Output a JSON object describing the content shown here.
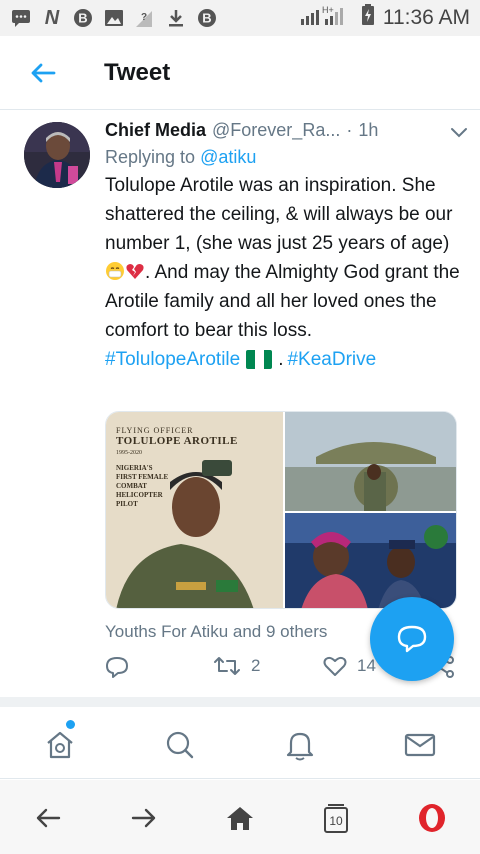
{
  "status_bar": {
    "time": "11:36 AM",
    "network": "H+"
  },
  "header": {
    "title": "Tweet"
  },
  "tweet": {
    "author_name": "Chief Media",
    "author_handle": "@Forever_Ra...",
    "separator": "·",
    "time": "1h",
    "replying_to_label": "Replying to",
    "replying_to_handle": "@atiku",
    "text_main": "Tolulope Arotile was an inspiration. She shattered the ceiling, & will always be our number 1, (she was just 25 years of age)",
    "text_after_emoji": ". And may the Almighty God grant the Arotile family and all her loved ones the comfort to bear this loss.",
    "hashtag_1": "#TolulopeArotile",
    "hashtag_sep": ".",
    "hashtag_2": "#KeaDrive",
    "likers": "Youths For Atiku and 9 others",
    "retweet_count": "2",
    "like_count": "14"
  },
  "media": {
    "poster_line1": "Flying Officer",
    "poster_line2": "Tolulope Arotile",
    "poster_years": "1995-2020",
    "poster_caption_1": "Nigeria's",
    "poster_caption_2": "First Female",
    "poster_caption_3": "Combat",
    "poster_caption_4": "Helicopter",
    "poster_caption_5": "Pilot"
  },
  "browser": {
    "tab_count": "10"
  },
  "colors": {
    "accent": "#1da1f2",
    "text": "#14171a",
    "muted": "#657786",
    "opera_red": "#e0242b"
  }
}
